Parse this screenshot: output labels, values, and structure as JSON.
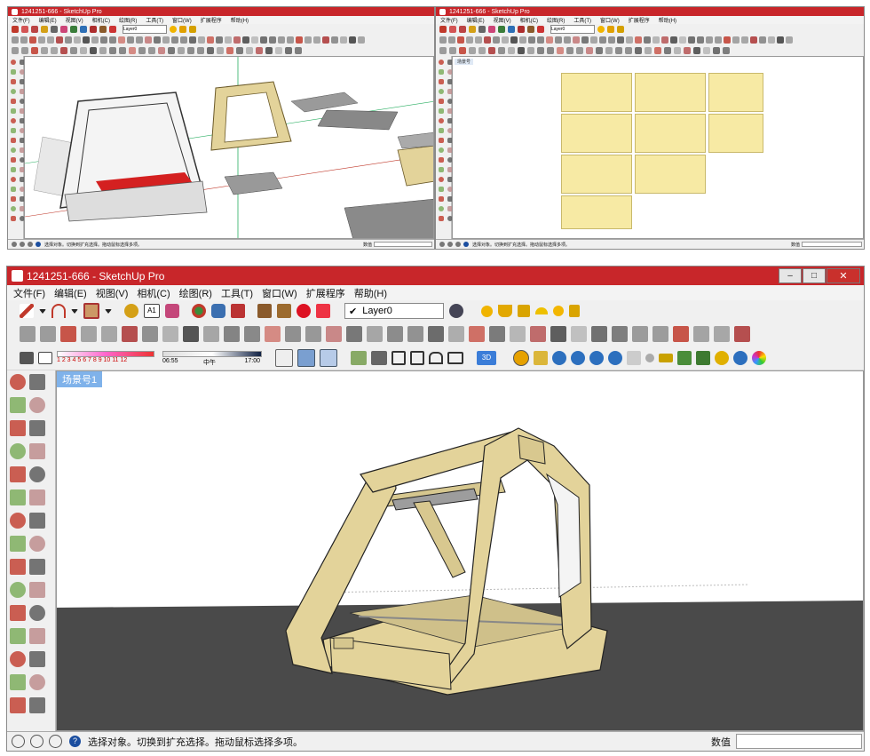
{
  "top_left": {
    "title": "1241251-666 - SketchUp Pro",
    "menus": [
      "文件(F)",
      "编辑(E)",
      "视图(V)",
      "相机(C)",
      "绘图(R)",
      "工具(T)",
      "窗口(W)",
      "扩展程序",
      "帮助(H)"
    ],
    "layer": "Layer0",
    "status": "选择对象。切换到扩充选择。拖动鼠标选择多项。",
    "vcb_label": "数值"
  },
  "top_right": {
    "title": "1241251-666 - SketchUp Pro",
    "menus": [
      "文件(F)",
      "编辑(E)",
      "视图(V)",
      "相机(C)",
      "绘图(R)",
      "工具(T)",
      "窗口(W)",
      "扩展程序",
      "帮助(H)"
    ],
    "layer": "Layer0",
    "scene_tab": "场景号",
    "status": "选择对象。切换到扩充选择。拖动鼠标选择多项。",
    "vcb_label": "数值"
  },
  "main": {
    "title": "1241251-666 - SketchUp Pro",
    "menus": [
      "文件(F)",
      "编辑(E)",
      "视图(V)",
      "相机(C)",
      "绘图(R)",
      "工具(T)",
      "窗口(W)",
      "扩展程序",
      "帮助(H)"
    ],
    "layer": "Layer0",
    "shadow_scale": "1 2 3 4 5 6 7 8 9 10 11 12",
    "time_start": "06:55",
    "time_mid": "中午",
    "time_end": "17:00",
    "scene_tab": "场景号1",
    "status": "选择对象。切换到扩充选择。拖动鼠标选择多项。",
    "vcb_label": "数值",
    "colors": {
      "title_red": "#c8262a",
      "ground": "#4a4a4a",
      "wood": "#e3d39a",
      "scene_tab": "#7fb2ea"
    }
  }
}
